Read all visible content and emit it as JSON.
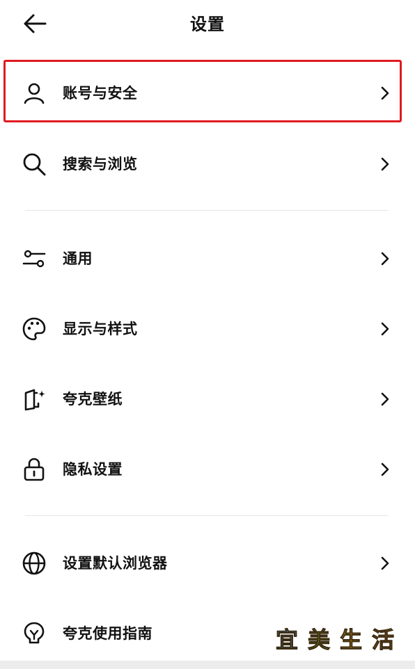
{
  "header": {
    "title": "设置",
    "back_icon": "arrow-left-icon"
  },
  "menu": [
    {
      "label": "账号与安全",
      "icon": "user-icon",
      "highlighted": true
    },
    {
      "label": "搜索与浏览",
      "icon": "search-icon"
    },
    {
      "label": "通用",
      "icon": "sliders-icon"
    },
    {
      "label": "显示与样式",
      "icon": "palette-icon"
    },
    {
      "label": "夸克壁纸",
      "icon": "wallpaper-sparkle-icon"
    },
    {
      "label": "隐私设置",
      "icon": "lock-icon"
    },
    {
      "label": "设置默认浏览器",
      "icon": "globe-icon"
    },
    {
      "label": "夸克使用指南",
      "icon": "lightbulb-icon"
    }
  ],
  "watermark": {
    "chars": [
      "宜",
      "美",
      "生",
      "活"
    ],
    "colors": [
      "#3fa9f5",
      "#8fd43a",
      "#f5c52a",
      "#f08c3a"
    ]
  },
  "colors": {
    "highlight_border": "#e0191f",
    "text": "#111111",
    "divider": "#e7e7e7"
  }
}
